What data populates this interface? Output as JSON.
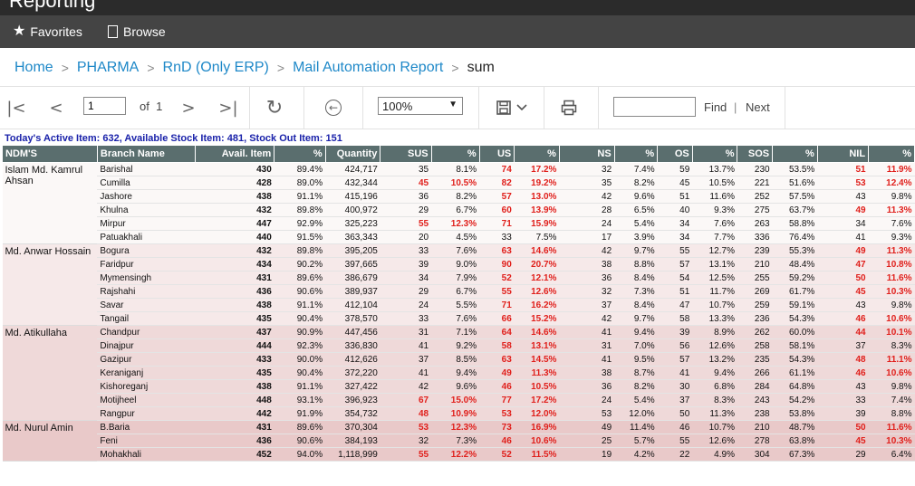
{
  "window": {
    "title": "Reporting"
  },
  "nav": {
    "favorites": "Favorites",
    "browse": "Browse"
  },
  "breadcrumb": {
    "items": [
      "Home",
      "PHARMA",
      "RnD (Only ERP)",
      "Mail Automation Report"
    ],
    "current": "sum"
  },
  "toolbar": {
    "page": "1",
    "of_label": "of",
    "total_pages": "1",
    "zoom": "100%",
    "find_label": "Find",
    "next_label": "Next",
    "find_separator": "|"
  },
  "report": {
    "summary": "Today's Active Item: 632, Available Stock Item: 481, Stock Out Item: 151",
    "headers": [
      "NDM'S",
      "Branch Name",
      "Avail. Item",
      "%",
      "Quantity",
      "SUS",
      "%",
      "US",
      "%",
      "NS",
      "%",
      "OS",
      "%",
      "SOS",
      "%",
      "NIL",
      "%"
    ],
    "groups": [
      {
        "ndm": "Islam Md. Kamrul Ahsan",
        "rows": [
          [
            "Barishal",
            "430",
            "89.4%",
            "424,717",
            "35",
            "8.1%",
            "74",
            "17.2%",
            "32",
            "7.4%",
            "59",
            "13.7%",
            "230",
            "53.5%",
            "51",
            "11.9%"
          ],
          [
            "Cumilla",
            "428",
            "89.0%",
            "432,344",
            "45",
            "10.5%",
            "82",
            "19.2%",
            "35",
            "8.2%",
            "45",
            "10.5%",
            "221",
            "51.6%",
            "53",
            "12.4%"
          ],
          [
            "Jashore",
            "438",
            "91.1%",
            "415,196",
            "36",
            "8.2%",
            "57",
            "13.0%",
            "42",
            "9.6%",
            "51",
            "11.6%",
            "252",
            "57.5%",
            "43",
            "9.8%"
          ],
          [
            "Khulna",
            "432",
            "89.8%",
            "400,972",
            "29",
            "6.7%",
            "60",
            "13.9%",
            "28",
            "6.5%",
            "40",
            "9.3%",
            "275",
            "63.7%",
            "49",
            "11.3%"
          ],
          [
            "Mirpur",
            "447",
            "92.9%",
            "325,223",
            "55",
            "12.3%",
            "71",
            "15.9%",
            "24",
            "5.4%",
            "34",
            "7.6%",
            "263",
            "58.8%",
            "34",
            "7.6%"
          ],
          [
            "Patuakhali",
            "440",
            "91.5%",
            "363,343",
            "20",
            "4.5%",
            "33",
            "7.5%",
            "17",
            "3.9%",
            "34",
            "7.7%",
            "336",
            "76.4%",
            "41",
            "9.3%"
          ]
        ]
      },
      {
        "ndm": "Md. Anwar Hossain",
        "rows": [
          [
            "Bogura",
            "432",
            "89.8%",
            "395,205",
            "33",
            "7.6%",
            "63",
            "14.6%",
            "42",
            "9.7%",
            "55",
            "12.7%",
            "239",
            "55.3%",
            "49",
            "11.3%"
          ],
          [
            "Faridpur",
            "434",
            "90.2%",
            "397,665",
            "39",
            "9.0%",
            "90",
            "20.7%",
            "38",
            "8.8%",
            "57",
            "13.1%",
            "210",
            "48.4%",
            "47",
            "10.8%"
          ],
          [
            "Mymensingh",
            "431",
            "89.6%",
            "386,679",
            "34",
            "7.9%",
            "52",
            "12.1%",
            "36",
            "8.4%",
            "54",
            "12.5%",
            "255",
            "59.2%",
            "50",
            "11.6%"
          ],
          [
            "Rajshahi",
            "436",
            "90.6%",
            "389,937",
            "29",
            "6.7%",
            "55",
            "12.6%",
            "32",
            "7.3%",
            "51",
            "11.7%",
            "269",
            "61.7%",
            "45",
            "10.3%"
          ],
          [
            "Savar",
            "438",
            "91.1%",
            "412,104",
            "24",
            "5.5%",
            "71",
            "16.2%",
            "37",
            "8.4%",
            "47",
            "10.7%",
            "259",
            "59.1%",
            "43",
            "9.8%"
          ],
          [
            "Tangail",
            "435",
            "90.4%",
            "378,570",
            "33",
            "7.6%",
            "66",
            "15.2%",
            "42",
            "9.7%",
            "58",
            "13.3%",
            "236",
            "54.3%",
            "46",
            "10.6%"
          ]
        ]
      },
      {
        "ndm": "Md. Atikullaha",
        "rows": [
          [
            "Chandpur",
            "437",
            "90.9%",
            "447,456",
            "31",
            "7.1%",
            "64",
            "14.6%",
            "41",
            "9.4%",
            "39",
            "8.9%",
            "262",
            "60.0%",
            "44",
            "10.1%"
          ],
          [
            "Dinajpur",
            "444",
            "92.3%",
            "336,830",
            "41",
            "9.2%",
            "58",
            "13.1%",
            "31",
            "7.0%",
            "56",
            "12.6%",
            "258",
            "58.1%",
            "37",
            "8.3%"
          ],
          [
            "Gazipur",
            "433",
            "90.0%",
            "412,626",
            "37",
            "8.5%",
            "63",
            "14.5%",
            "41",
            "9.5%",
            "57",
            "13.2%",
            "235",
            "54.3%",
            "48",
            "11.1%"
          ],
          [
            "Keraniganj",
            "435",
            "90.4%",
            "372,220",
            "41",
            "9.4%",
            "49",
            "11.3%",
            "38",
            "8.7%",
            "41",
            "9.4%",
            "266",
            "61.1%",
            "46",
            "10.6%"
          ],
          [
            "Kishoreganj",
            "438",
            "91.1%",
            "327,422",
            "42",
            "9.6%",
            "46",
            "10.5%",
            "36",
            "8.2%",
            "30",
            "6.8%",
            "284",
            "64.8%",
            "43",
            "9.8%"
          ],
          [
            "Motijheel",
            "448",
            "93.1%",
            "396,923",
            "67",
            "15.0%",
            "77",
            "17.2%",
            "24",
            "5.4%",
            "37",
            "8.3%",
            "243",
            "54.2%",
            "33",
            "7.4%"
          ],
          [
            "Rangpur",
            "442",
            "91.9%",
            "354,732",
            "48",
            "10.9%",
            "53",
            "12.0%",
            "53",
            "12.0%",
            "50",
            "11.3%",
            "238",
            "53.8%",
            "39",
            "8.8%"
          ]
        ]
      },
      {
        "ndm": "Md. Nurul Amin",
        "rows": [
          [
            "B.Baria",
            "431",
            "89.6%",
            "370,304",
            "53",
            "12.3%",
            "73",
            "16.9%",
            "49",
            "11.4%",
            "46",
            "10.7%",
            "210",
            "48.7%",
            "50",
            "11.6%"
          ],
          [
            "Feni",
            "436",
            "90.6%",
            "384,193",
            "32",
            "7.3%",
            "46",
            "10.6%",
            "25",
            "5.7%",
            "55",
            "12.6%",
            "278",
            "63.8%",
            "45",
            "10.3%"
          ],
          [
            "Mohakhali",
            "452",
            "94.0%",
            "1,118,999",
            "55",
            "12.2%",
            "52",
            "11.5%",
            "19",
            "4.2%",
            "22",
            "4.9%",
            "304",
            "67.3%",
            "29",
            "6.4%"
          ]
        ]
      }
    ]
  }
}
